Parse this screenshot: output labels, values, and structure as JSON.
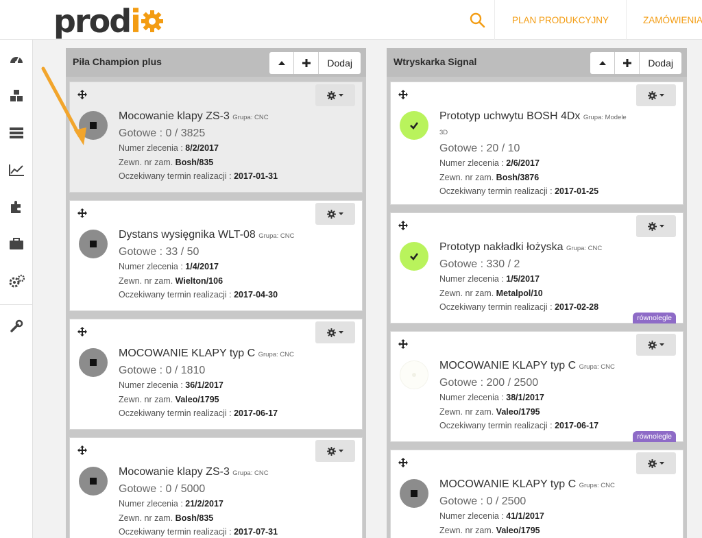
{
  "header": {
    "logo_left": "prod",
    "logo_accent": "i",
    "nav_plan": "PLAN PRODUKCYJNY",
    "nav_orders": "ZAMÓWIENIA"
  },
  "accent_color": "#f39c12",
  "sidebar": {
    "items": [
      {
        "icon": "dashboard-icon"
      },
      {
        "icon": "cubes-icon"
      },
      {
        "icon": "server-icon"
      },
      {
        "icon": "chart-icon"
      },
      {
        "icon": "puzzle-icon"
      },
      {
        "icon": "briefcase-icon"
      },
      {
        "icon": "cogs-icon"
      },
      {
        "icon": "wrench-icon"
      }
    ]
  },
  "labels": {
    "gotowe": "Gotowe : ",
    "numer": "Numer zlecenia : ",
    "zewn": "Zewn. nr zam. ",
    "termin": "Oczekiwany termin realizacji : ",
    "add": "Dodaj"
  },
  "columns": [
    {
      "title": "Piła Champion plus",
      "cards": [
        {
          "name": "Mocowanie klapy ZS-3",
          "group": "Grupa: CNC",
          "done": "0 / 3825",
          "order": "8/2/2017",
          "ext": "Bosh/835",
          "date": "2017-01-31",
          "status": "stop"
        },
        {
          "name": "Dystans wysięgnika WLT-08",
          "group": "Grupa: CNC",
          "done": "33 / 50",
          "order": "1/4/2017",
          "ext": "Wielton/106",
          "date": "2017-04-30",
          "status": "stop"
        },
        {
          "name": "MOCOWANIE KLAPY typ C",
          "group": "Grupa: CNC",
          "done": "0 / 1810",
          "order": "36/1/2017",
          "ext": "Valeo/1795",
          "date": "2017-06-17",
          "status": "stop"
        },
        {
          "name": "Mocowanie klapy ZS-3",
          "group": "Grupa: CNC",
          "done": "0 / 5000",
          "order": "21/2/2017",
          "ext": "Bosh/835",
          "date": "2017-07-31",
          "status": "stop"
        }
      ]
    },
    {
      "title": "Wtryskarka Signal",
      "cards": [
        {
          "name": "Prototyp uchwytu BOSH 4Dx",
          "group": "Grupa: Modele 3D",
          "done": "20 / 10",
          "order": "2/6/2017",
          "ext": "Bosh/3876",
          "date": "2017-01-25",
          "status": "done"
        },
        {
          "name": "Prototyp nakładki łożyska",
          "group": "Grupa: CNC",
          "done": "330 / 2",
          "order": "1/5/2017",
          "ext": "Metalpol/10",
          "date": "2017-02-28",
          "status": "done",
          "badge": "równolegle"
        },
        {
          "name": "MOCOWANIE KLAPY typ C",
          "group": "Grupa: CNC",
          "done": "200 / 2500",
          "order": "38/1/2017",
          "ext": "Valeo/1795",
          "date": "2017-06-17",
          "status": "faint",
          "badge": "równolegle"
        },
        {
          "name": "MOCOWANIE KLAPY typ C",
          "group": "Grupa: CNC",
          "done": "0 / 2500",
          "order": "41/1/2017",
          "ext": "Valeo/1795",
          "date": "",
          "status": "stop"
        }
      ]
    }
  ]
}
